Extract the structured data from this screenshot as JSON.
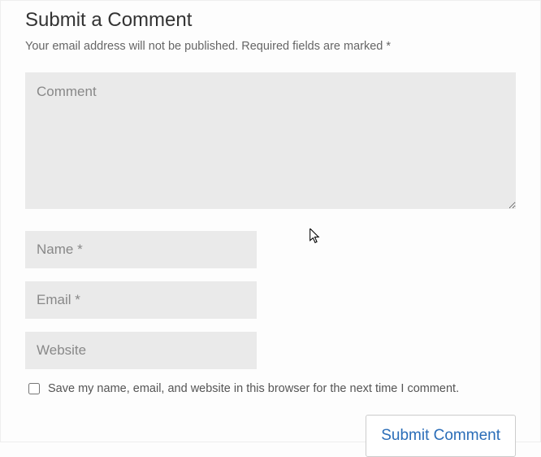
{
  "heading": "Submit a Comment",
  "subtext": "Your email address will not be published. Required fields are marked *",
  "fields": {
    "comment_placeholder": "Comment",
    "name_placeholder": "Name *",
    "email_placeholder": "Email *",
    "website_placeholder": "Website"
  },
  "save_label": "Save my name, email, and website in this browser for the next time I comment.",
  "submit_label": "Submit Comment"
}
